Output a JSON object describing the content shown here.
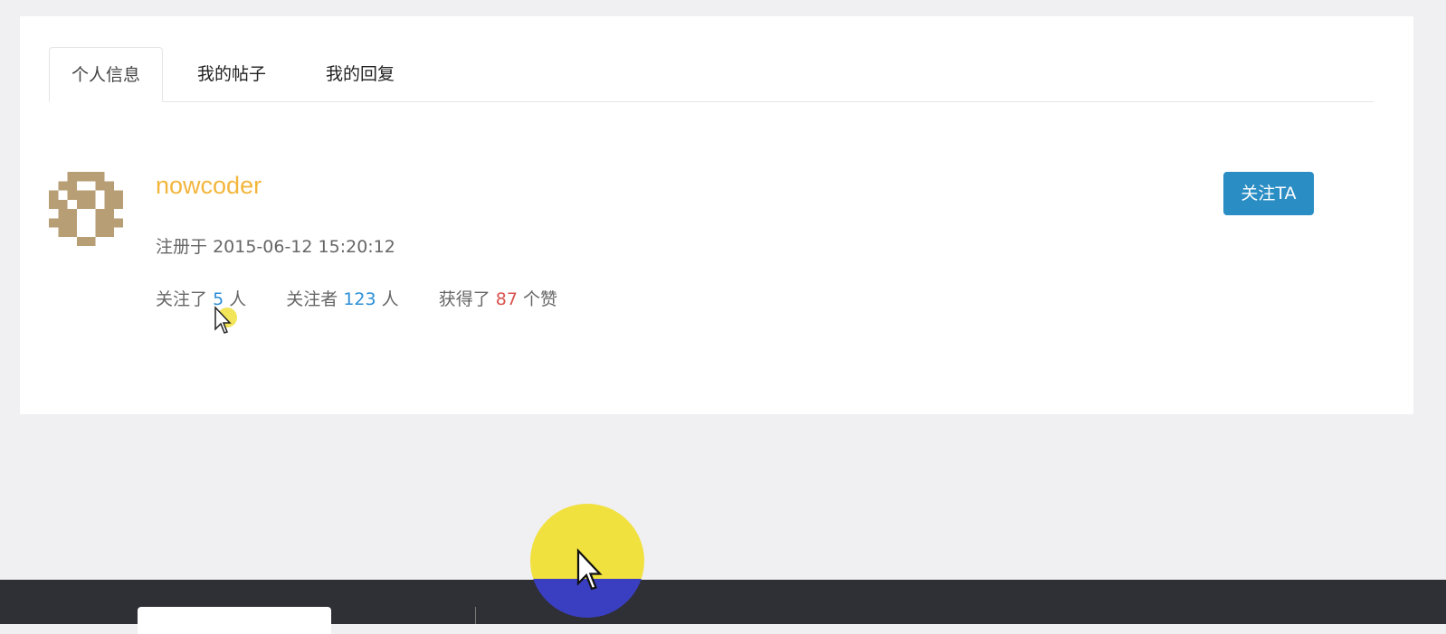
{
  "tabs": [
    {
      "label": "个人信息",
      "active": true
    },
    {
      "label": "我的帖子",
      "active": false
    },
    {
      "label": "我的回复",
      "active": false
    }
  ],
  "profile": {
    "username": "nowcoder",
    "registered_label": "注册于",
    "registered_at": "2015-06-12 15:20:12",
    "stats": {
      "following_prefix": "关注了",
      "following_count": "5",
      "following_suffix": "人",
      "followers_prefix": "关注者",
      "followers_count": "123",
      "followers_suffix": "人",
      "likes_prefix": "获得了",
      "likes_count": "87",
      "likes_suffix": "个赞"
    },
    "follow_button": "关注TA"
  },
  "colors": {
    "username": "#f3b63d",
    "accent_blue": "#2a8dc4",
    "count_blue": "#2c8fd6",
    "count_red": "#d9534f",
    "footer_bg": "#2f2f36"
  },
  "icons": {
    "avatar": "pixel-identicon-avatar",
    "cursor": "mouse-pointer-icon"
  }
}
